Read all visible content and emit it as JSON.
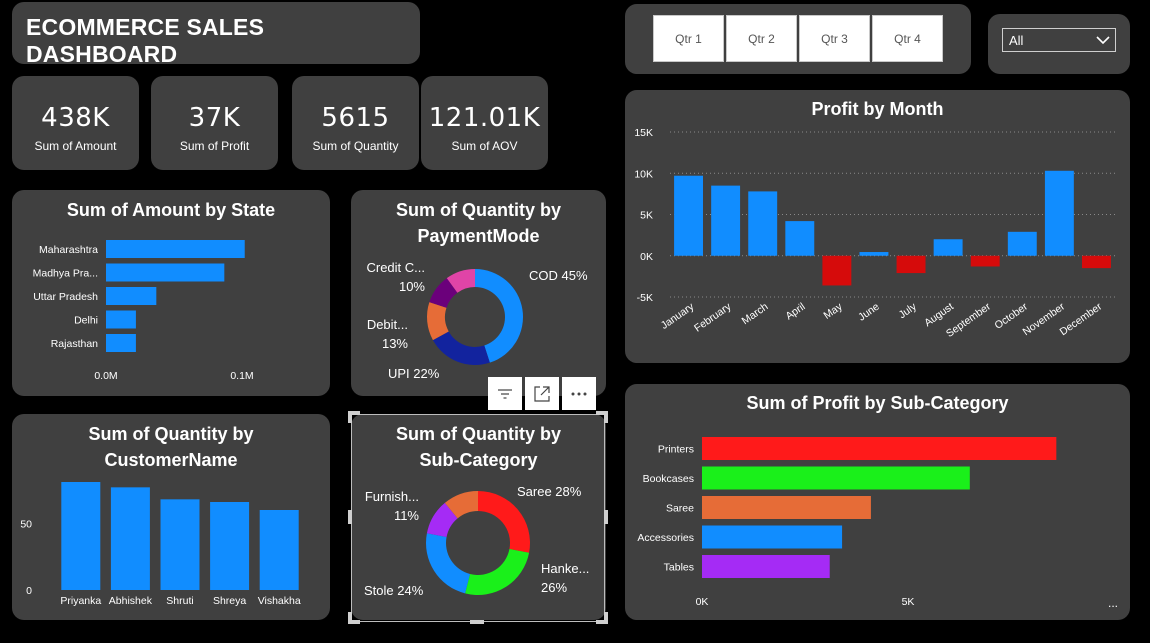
{
  "dashboard": {
    "title": "ECOMMERCE SALES DASHBOARD"
  },
  "kpis": [
    {
      "value": "438K",
      "label": "Sum of Amount"
    },
    {
      "value": "37K",
      "label": "Sum of Profit"
    },
    {
      "value": "5615",
      "label": "Sum of Quantity"
    },
    {
      "value": "121.01K",
      "label": "Sum of AOV"
    }
  ],
  "quarter_slicer": [
    "Qtr 1",
    "Qtr 2",
    "Qtr 3",
    "Qtr 4"
  ],
  "dropdown": {
    "selected": "All"
  },
  "colors": {
    "blue": "#118DFF",
    "red": "#D60B0B",
    "panel": "#404040"
  },
  "chart_data": [
    {
      "id": "amount_by_state",
      "type": "bar",
      "orientation": "horizontal",
      "title": "Sum of Amount by State",
      "categories": [
        "Maharashtra",
        "Madhya Pra...",
        "Uttar Pradesh",
        "Delhi",
        "Rajasthan"
      ],
      "values": [
        0.102,
        0.087,
        0.037,
        0.022,
        0.022
      ],
      "xticks": [
        "0.0M",
        "0.1M"
      ],
      "tick_values": [
        0,
        0.1
      ],
      "xlim": [
        0,
        0.2
      ]
    },
    {
      "id": "quantity_by_paymentmode",
      "type": "pie",
      "donut": true,
      "title": "Sum of Quantity by PaymentMode",
      "segments": [
        {
          "label": "COD",
          "pct": 45,
          "color": "#118DFF",
          "text": [
            "COD 45%"
          ]
        },
        {
          "label": "UPI",
          "pct": 22,
          "color": "#12239E",
          "text": [
            "UPI 22%"
          ]
        },
        {
          "label": "Debit...",
          "pct": 13,
          "color": "#E66C37",
          "text": [
            "Debit...",
            "13%"
          ]
        },
        {
          "label": "Credit C...",
          "pct": 10,
          "color": "#6B007B",
          "text": [
            "Credit C...",
            "10%"
          ]
        },
        {
          "label": "other",
          "pct": 10,
          "color": "#E044A7",
          "text": []
        }
      ]
    },
    {
      "id": "profit_by_month",
      "type": "bar",
      "title": "Profit by Month",
      "categories": [
        "January",
        "February",
        "March",
        "April",
        "May",
        "June",
        "July",
        "August",
        "September",
        "October",
        "November",
        "December"
      ],
      "values": [
        9700,
        8500,
        7800,
        4200,
        -3600,
        450,
        -2100,
        2000,
        -1300,
        2900,
        10300,
        -1500
      ],
      "yticks": [
        "15K",
        "10K",
        "5K",
        "0K",
        "-5K"
      ],
      "tick_values": [
        15000,
        10000,
        5000,
        0,
        -5000
      ],
      "ylim": [
        -5000,
        15000
      ],
      "grid": true
    },
    {
      "id": "quantity_by_customer",
      "type": "bar",
      "title": "Sum of Quantity by CustomerName",
      "categories": [
        "Priyanka",
        "Abhishek",
        "Shruti",
        "Shreya",
        "Vishakha"
      ],
      "values": [
        81,
        77,
        68,
        66,
        60
      ],
      "yticks": [
        "50",
        "0"
      ],
      "tick_values": [
        50,
        0
      ],
      "ylim": [
        0,
        90
      ]
    },
    {
      "id": "quantity_by_subcategory",
      "type": "pie",
      "donut": true,
      "title": "Sum of Quantity by Sub-Category",
      "segments": [
        {
          "label": "Saree",
          "pct": 28,
          "color": "#FF1A1A",
          "text": [
            "Saree 28%"
          ]
        },
        {
          "label": "Hanke...",
          "pct": 26,
          "color": "#1AF01A",
          "text": [
            "Hanke...",
            "26%"
          ]
        },
        {
          "label": "Stole",
          "pct": 24,
          "color": "#118DFF",
          "text": [
            "Stole 24%"
          ]
        },
        {
          "label": "Furnish...",
          "pct": 11,
          "color": "#A52BF5",
          "text": [
            "Furnish...",
            "11%"
          ]
        },
        {
          "label": "other",
          "pct": 11,
          "color": "#E66C37",
          "text": []
        }
      ]
    },
    {
      "id": "profit_by_subcategory",
      "type": "bar",
      "orientation": "horizontal",
      "title": "Sum of Profit by Sub-Category",
      "categories": [
        "Printers",
        "Bookcases",
        "Saree",
        "Accessories",
        "Tables"
      ],
      "values": [
        8600,
        6500,
        4100,
        3400,
        3100
      ],
      "colors": [
        "#FF1A1A",
        "#1AF01A",
        "#E66C37",
        "#118DFF",
        "#A52BF5"
      ],
      "xticks": [
        "0K",
        "5K"
      ],
      "tick_values": [
        0,
        5000
      ],
      "xlim": [
        0,
        10000
      ]
    }
  ]
}
